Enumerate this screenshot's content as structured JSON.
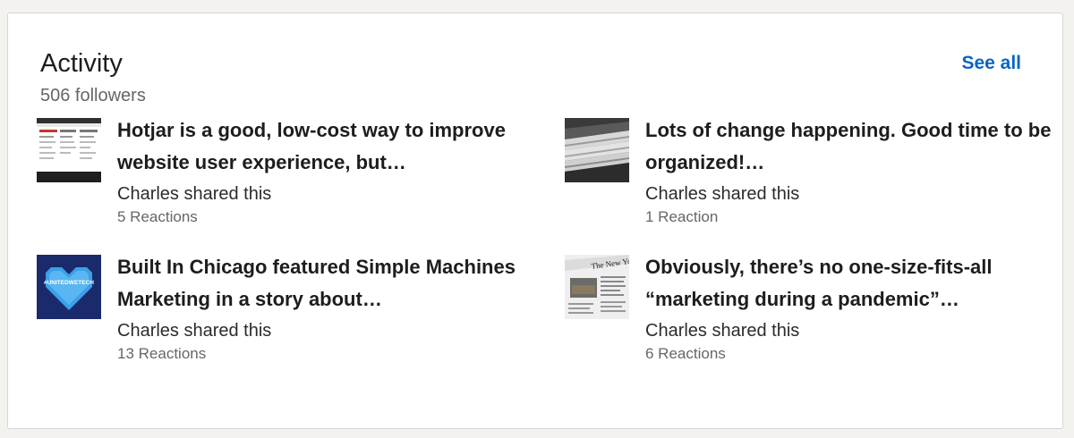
{
  "activity": {
    "title": "Activity",
    "followers": "506 followers",
    "see_all": "See all"
  },
  "posts": [
    {
      "headline": "Hotjar is a good, low-cost way to improve website user experience, but…",
      "shared": "Charles shared this",
      "reactions": "5 Reactions",
      "thumbnail": "website-screenshot-thumbnail"
    },
    {
      "headline": "Lots of change happening. Good time to be organized!…",
      "shared": "Charles shared this",
      "reactions": "1 Reaction",
      "thumbnail": "stacked-papers-thumbnail"
    },
    {
      "headline": "Built In Chicago featured Simple Machines Marketing in a story about…",
      "shared": "Charles shared this",
      "reactions": "13 Reactions",
      "thumbnail": "united-we-tech-heart-thumbnail",
      "thumb_text": "#UNITEDWETECH"
    },
    {
      "headline": "Obviously, there’s no one-size-fits-all “marketing during a pandemic”…",
      "shared": "Charles shared this",
      "reactions": "6 Reactions",
      "thumbnail": "newspaper-thumbnail"
    }
  ]
}
